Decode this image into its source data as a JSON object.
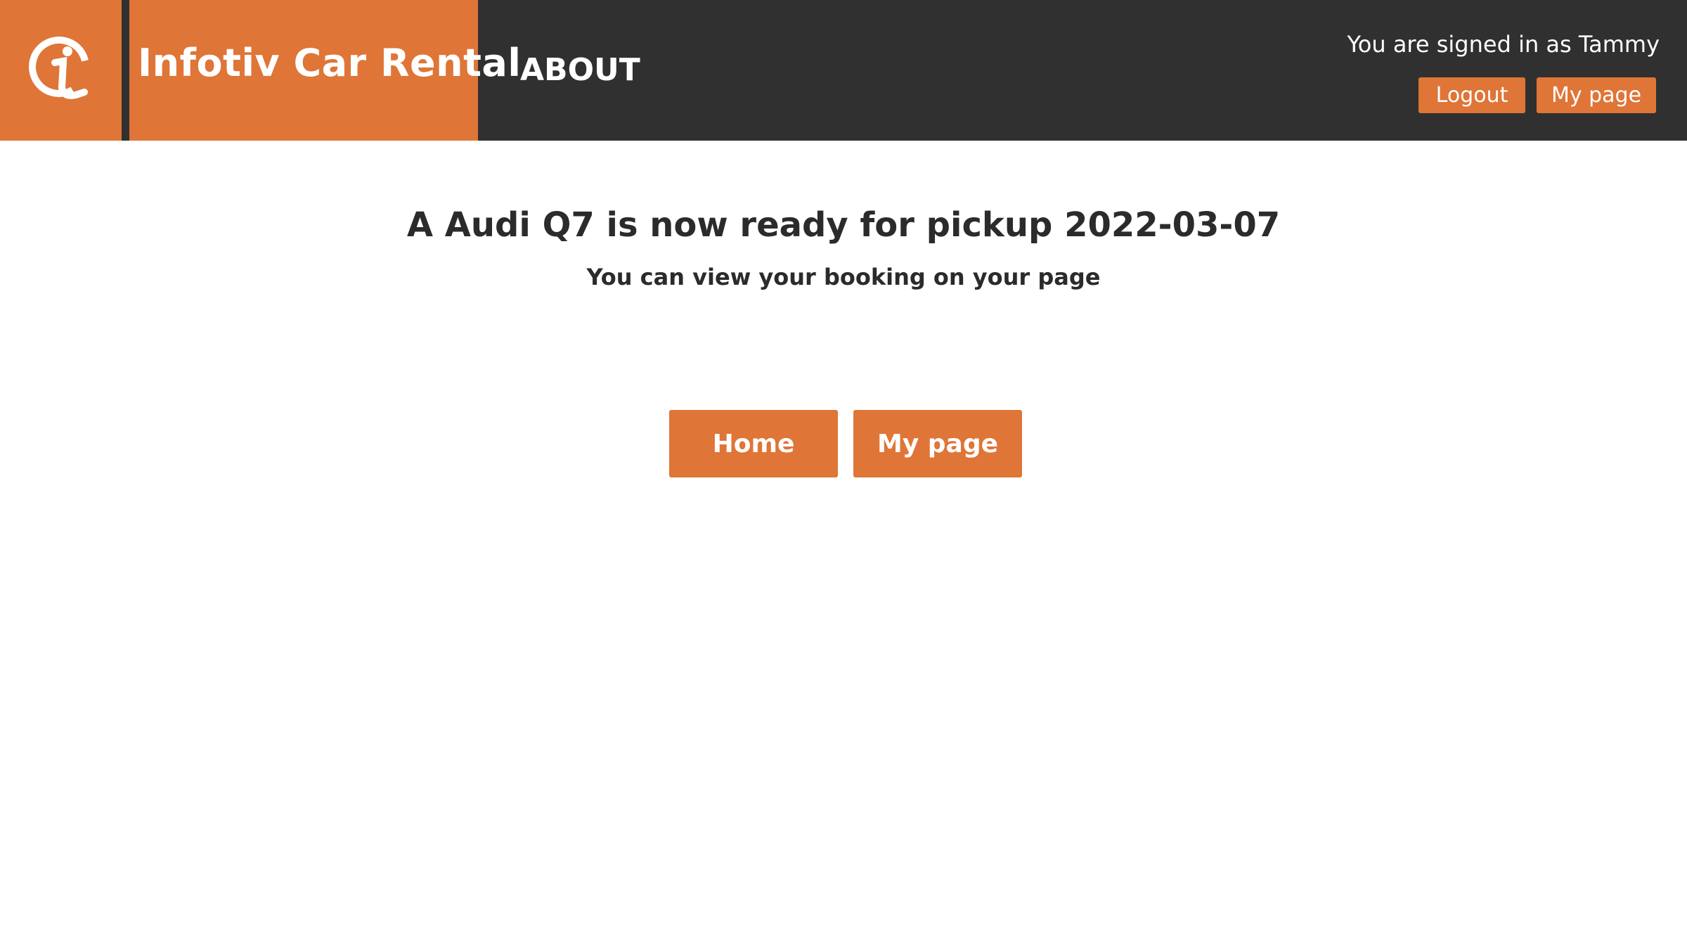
{
  "header": {
    "site_title": "Infotiv Car Rental",
    "nav_about": "ABOUT",
    "signed_in_text": "You are signed in as Tammy",
    "logout_label": "Logout",
    "mypage_label": "My page",
    "logo_icon": "infotiv-logo-icon"
  },
  "main": {
    "headline": "A Audi Q7 is now ready for pickup 2022-03-07",
    "subline": "You can view your booking on your page",
    "home_label": "Home",
    "mypage_label": "My page"
  },
  "colors": {
    "accent": "#df7537",
    "header_bg": "#303030",
    "text": "#2b2b2b"
  }
}
